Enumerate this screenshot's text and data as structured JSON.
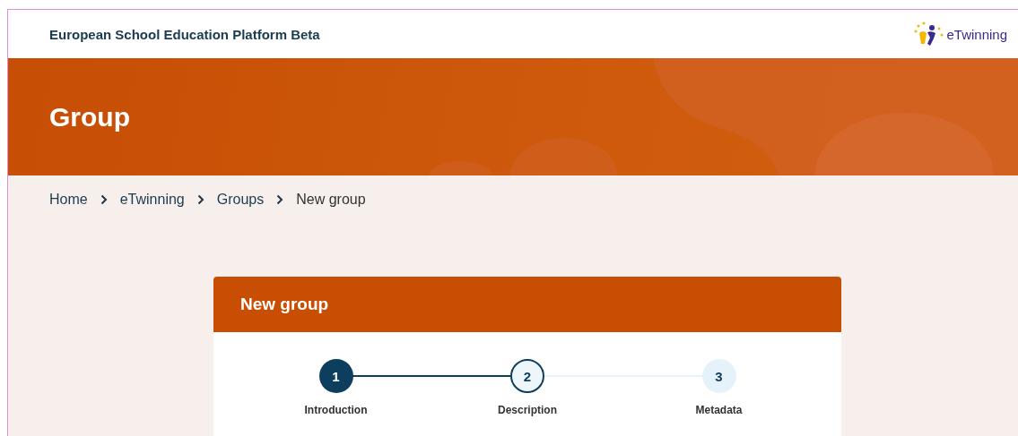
{
  "header": {
    "site_title": "European School Education Platform Beta",
    "logo_text": "eTwinning"
  },
  "banner": {
    "title": "Group"
  },
  "breadcrumb": [
    {
      "label": "Home",
      "kind": "link"
    },
    {
      "label": "eTwinning",
      "kind": "link"
    },
    {
      "label": "Groups",
      "kind": "link"
    },
    {
      "label": "New group",
      "kind": "current"
    }
  ],
  "card": {
    "title": "New group",
    "steps": [
      {
        "number": "1",
        "label": "Introduction",
        "completed": true,
        "selected": false
      },
      {
        "number": "2",
        "label": "Description",
        "completed": false,
        "selected": true
      },
      {
        "number": "3",
        "label": "Metadata",
        "completed": false,
        "selected": false
      }
    ]
  }
}
